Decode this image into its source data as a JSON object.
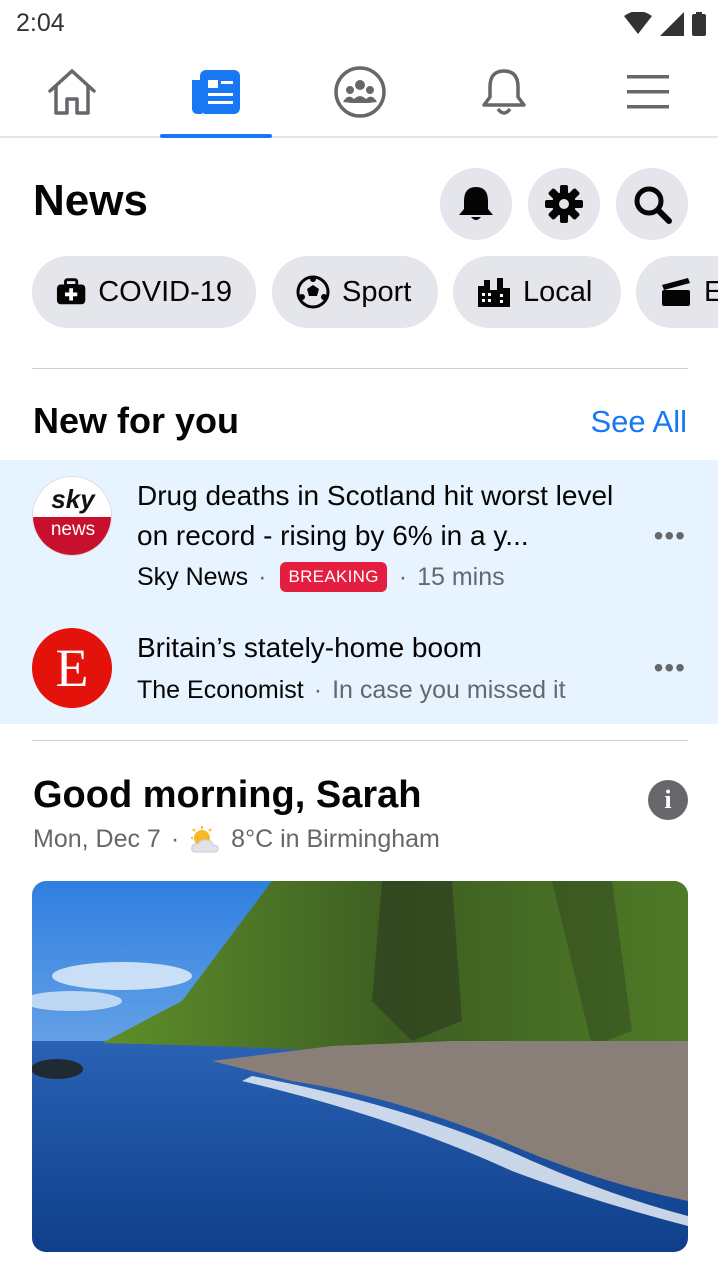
{
  "status_bar": {
    "time": "2:04"
  },
  "nav": {
    "tabs": [
      {
        "name": "home-icon"
      },
      {
        "name": "news-feed-icon",
        "active": true
      },
      {
        "name": "groups-icon"
      },
      {
        "name": "notifications-icon"
      },
      {
        "name": "menu-icon"
      }
    ],
    "accent": "#1877f2"
  },
  "header": {
    "title": "News"
  },
  "chips": [
    {
      "label": "COVID-19",
      "icon": "medical-kit-icon"
    },
    {
      "label": "Sport",
      "icon": "football-icon"
    },
    {
      "label": "Local",
      "icon": "city-icon"
    },
    {
      "label": "E",
      "icon": "clapperboard-icon"
    }
  ],
  "new_for_you": {
    "title": "New for you",
    "see_all": "See All",
    "items": [
      {
        "logo_line1": "sky",
        "logo_line2": "news",
        "headline": "Drug deaths in Scotland hit worst level on record - rising by 6% in a y...",
        "source": "Sky News",
        "badge": "BREAKING",
        "time": "15 mins",
        "more": "•••"
      },
      {
        "logo_letter": "E",
        "headline": "Britain’s stately-home boom",
        "source": "The Economist",
        "note": "In case you missed it",
        "more": "•••"
      }
    ]
  },
  "greeting": {
    "title": "Good morning, Sarah",
    "date": "Mon, Dec 7",
    "weather": "8°C in Birmingham",
    "info": "i"
  }
}
